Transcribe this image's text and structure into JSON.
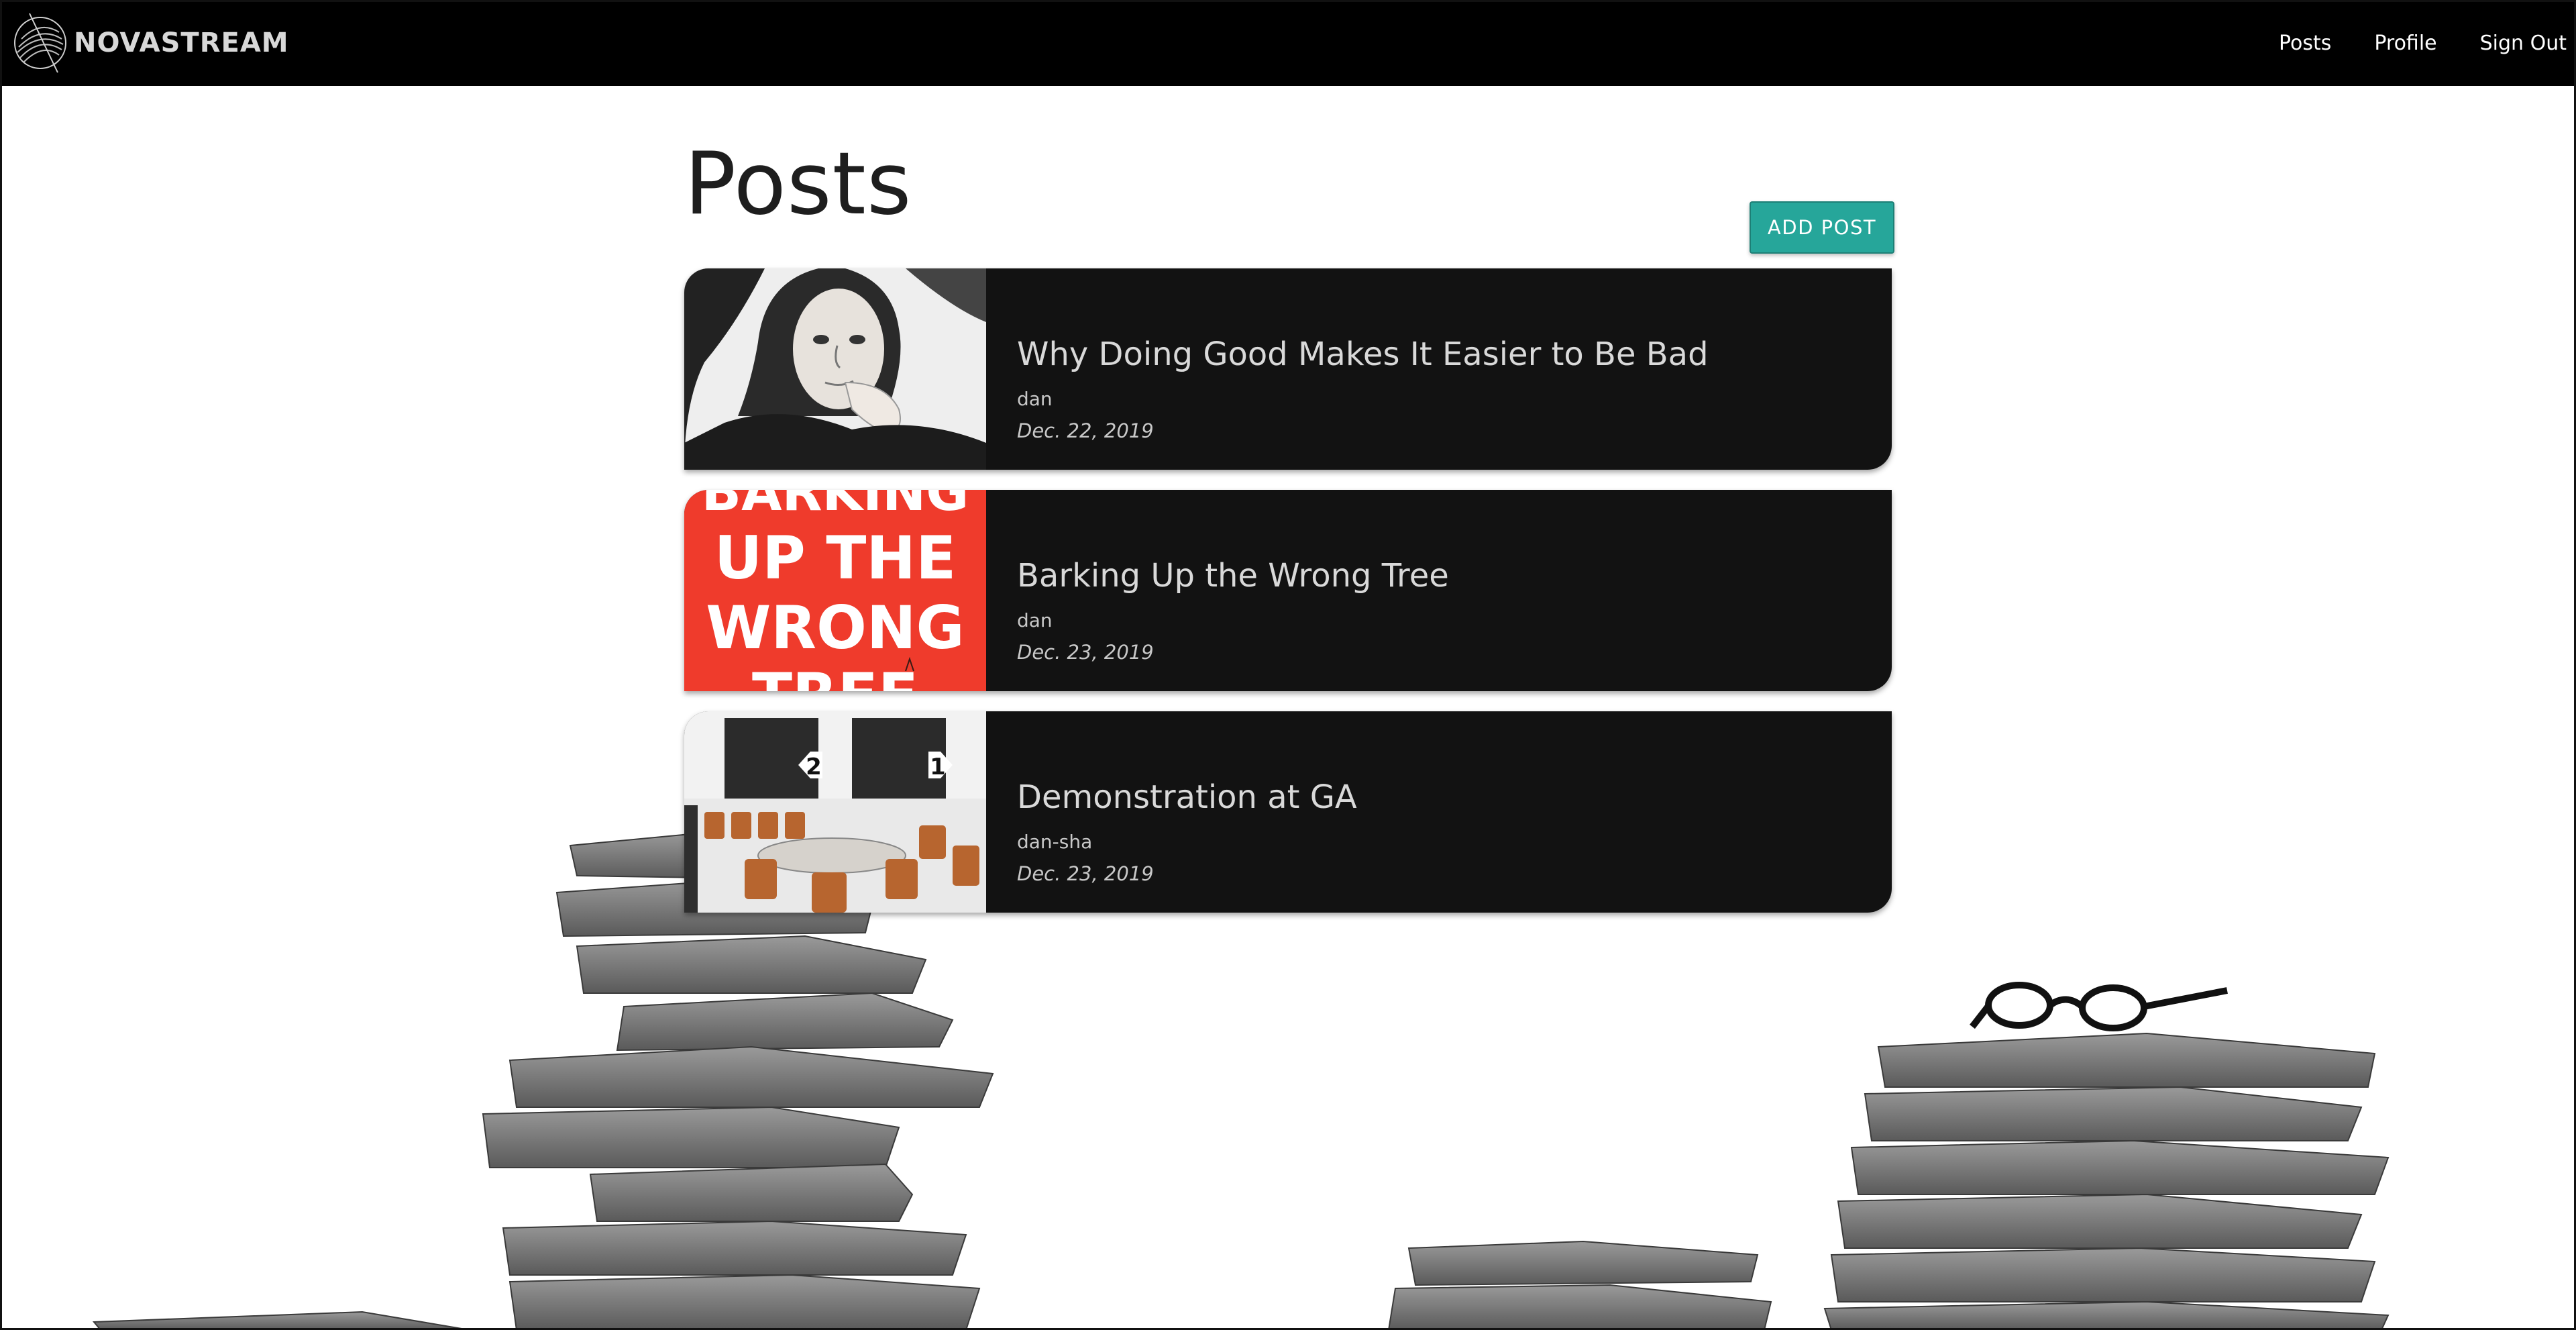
{
  "brand": {
    "name": "NOVASTREAM",
    "logo_icon": "globe-swirl-icon"
  },
  "nav": {
    "items": [
      {
        "label": "Posts"
      },
      {
        "label": "Profile"
      },
      {
        "label": "Sign Out"
      }
    ]
  },
  "page": {
    "title": "Posts",
    "add_button_label": "ADD POST"
  },
  "posts": [
    {
      "title": "Why Doing Good Makes It Easier to Be Bad",
      "author": "dan",
      "date": "Dec. 22, 2019",
      "thumbnail": "portrait-photo"
    },
    {
      "title": "Barking Up the Wrong Tree",
      "author": "dan",
      "date": "Dec. 23, 2019",
      "thumbnail": "book-cover",
      "thumbnail_lines": [
        "BARKING",
        "UP THE",
        "WRONG",
        "TREE"
      ]
    },
    {
      "title": "Demonstration at GA",
      "author": "dan-sha",
      "date": "Dec. 23, 2019",
      "thumbnail": "classroom-photo",
      "thumbnail_lines": [
        "2",
        "1"
      ]
    }
  ],
  "colors": {
    "navbar": "#000000",
    "accent": "#26a69a",
    "card": "#121212",
    "book_cover_red": "#ef3b2c"
  },
  "background": "stacks-of-papers-illustration"
}
